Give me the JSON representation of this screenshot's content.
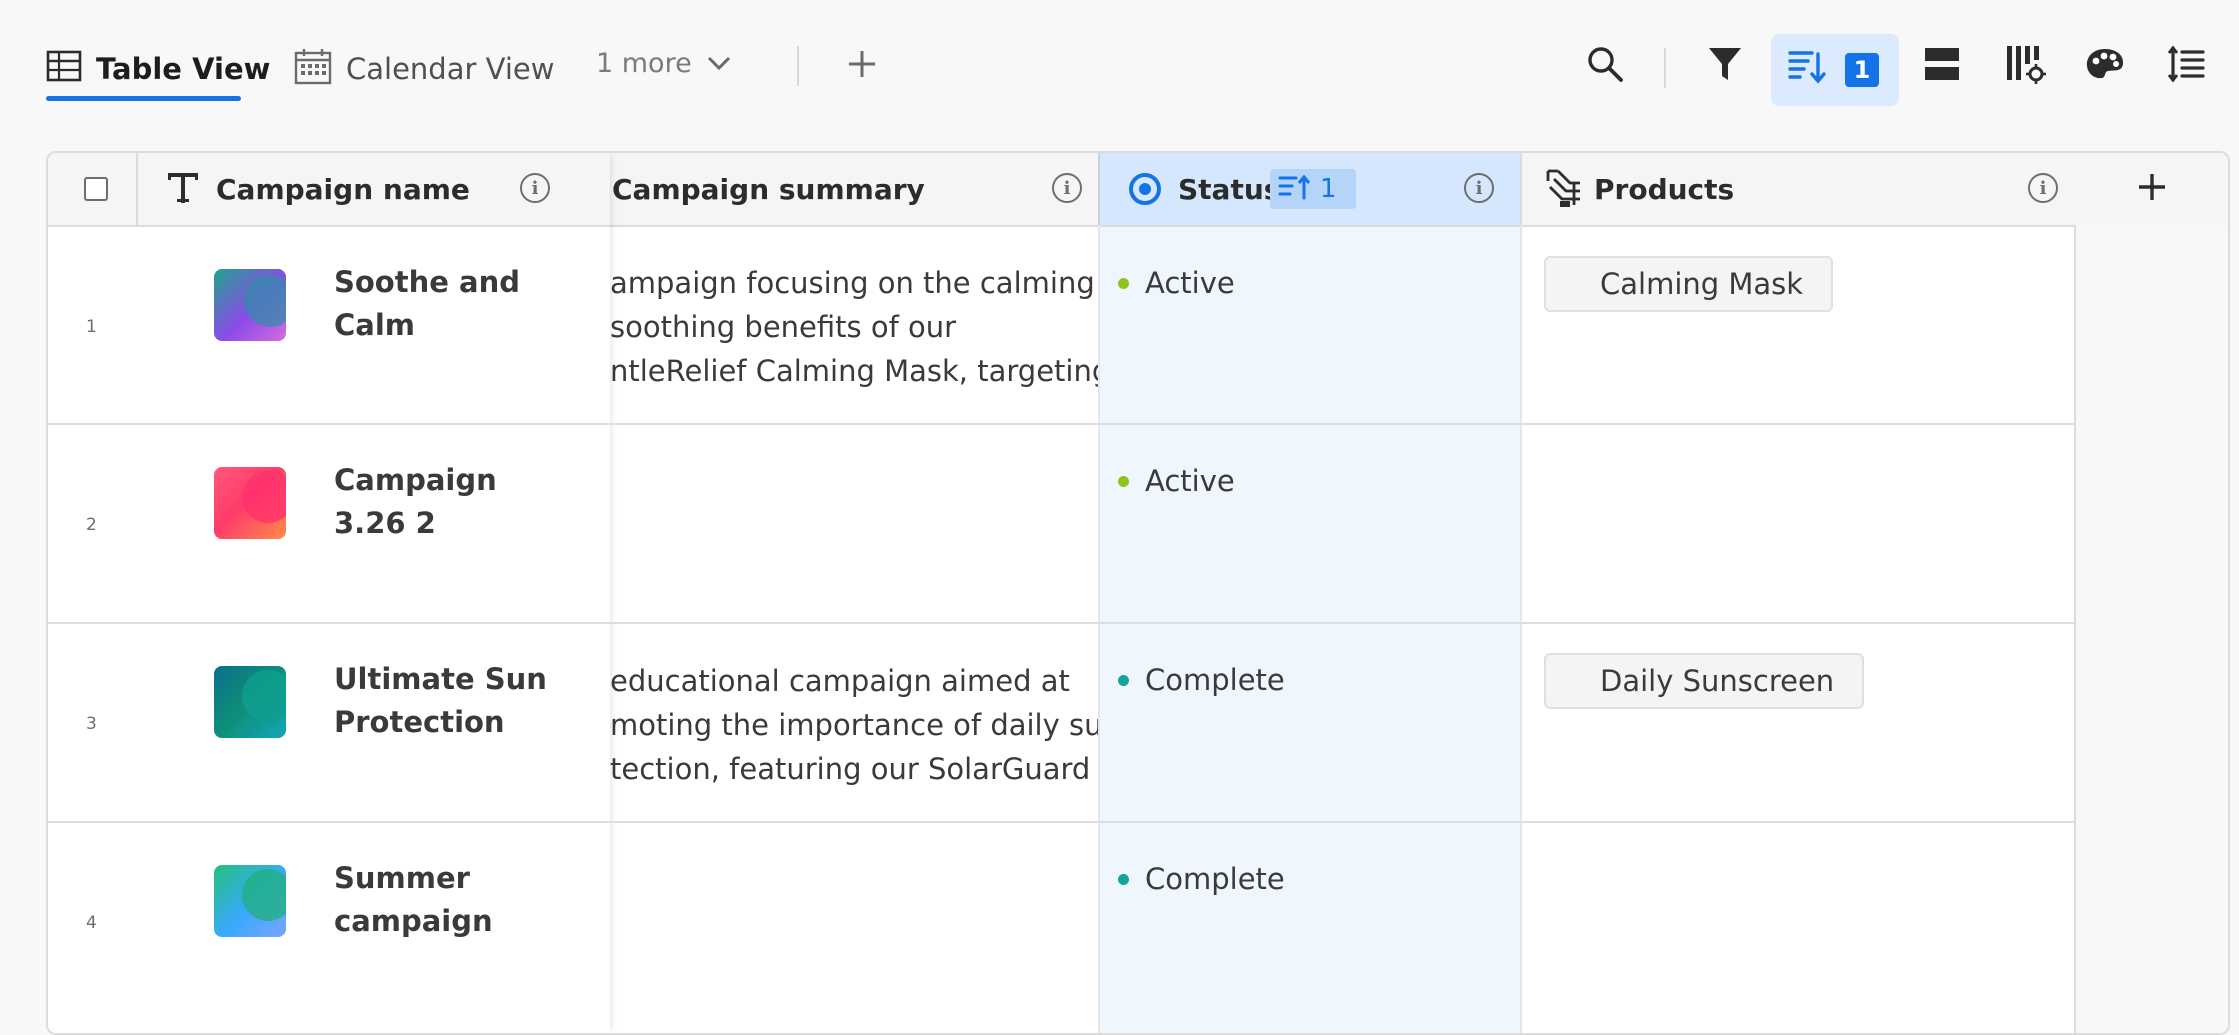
{
  "toolbar": {
    "tabs": [
      {
        "label": "Table View",
        "icon": "table-icon",
        "active": true
      },
      {
        "label": "Calendar View",
        "icon": "calendar-icon",
        "active": false
      }
    ],
    "more_label": "1 more",
    "add_view_icon": "plus-icon",
    "sort_count": "1",
    "right_icons": [
      "search-icon",
      "filter-icon",
      "sort-icon",
      "row-height-icon",
      "column-settings-icon",
      "color-palette-icon",
      "line-spacing-icon"
    ]
  },
  "table": {
    "columns": [
      {
        "label": "Campaign name",
        "icon": "text-type-icon"
      },
      {
        "label": "Campaign summary",
        "icon": ""
      },
      {
        "label": "Status",
        "icon": "status-icon",
        "sort_badge": "1"
      },
      {
        "label": "Products",
        "icon": "products-icon"
      }
    ],
    "rows": [
      {
        "num": "1",
        "name": "Soothe and Calm",
        "summary": [
          "ampaign focusing on the calming",
          "soothing benefits of our",
          "ntleRelief Calming Mask, targeting ..."
        ],
        "status": "Active",
        "status_color": "#8fc41f",
        "product": "Calming Mask",
        "thumb": [
          "#8a4be8",
          "#1fa58c",
          "#d46be0"
        ]
      },
      {
        "num": "2",
        "name": "Campaign 3.26 2",
        "summary": [],
        "status": "Active",
        "status_color": "#8fc41f",
        "product": "",
        "thumb": [
          "#ff3b6b",
          "#ff8b4a",
          "#ff5a7a"
        ]
      },
      {
        "num": "3",
        "name": "Ultimate Sun Protection",
        "summary": [
          "educational campaign aimed at",
          "moting the importance of daily sun",
          "tection, featuring our SolarGuard ..."
        ],
        "status": "Complete",
        "status_color": "#12a59b",
        "product": "Daily Sunscreen",
        "thumb": [
          "#0f8f7a",
          "#12a7b5",
          "#0b6e8a"
        ]
      },
      {
        "num": "4",
        "name": "Summer campaign",
        "summary": [],
        "status": "Complete",
        "status_color": "#12a59b",
        "product": "",
        "thumb": [
          "#3aa8ff",
          "#24c17a",
          "#7aa6ff"
        ]
      }
    ],
    "add_column_icon": "plus-icon"
  }
}
